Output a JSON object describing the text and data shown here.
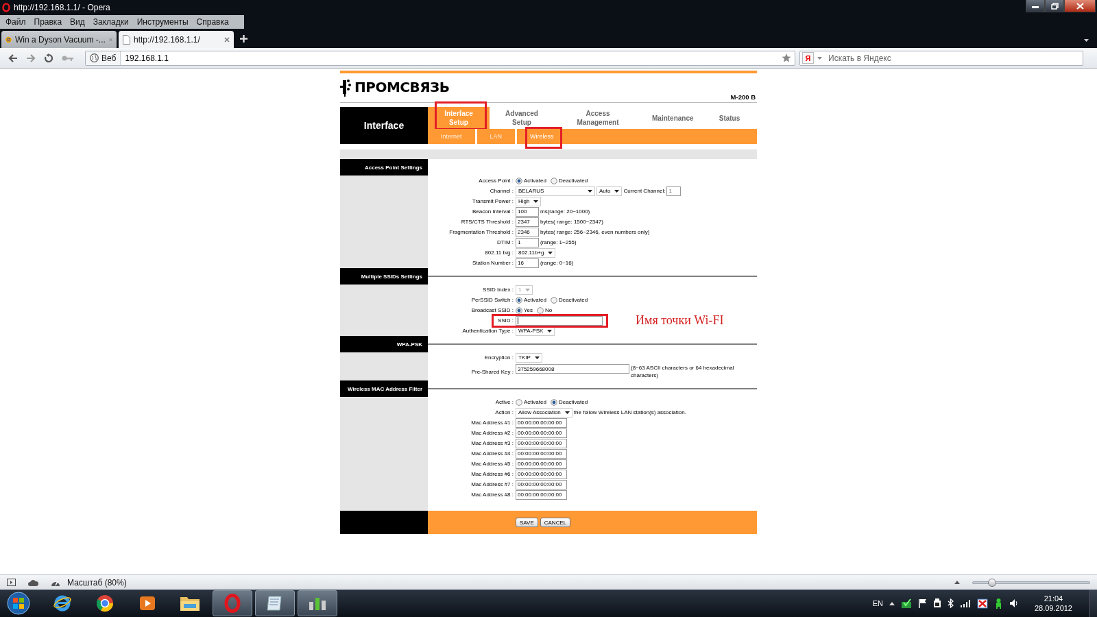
{
  "window": {
    "title": "http://192.168.1.1/ - Opera"
  },
  "menu": [
    "Файл",
    "Правка",
    "Вид",
    "Закладки",
    "Инструменты",
    "Справка"
  ],
  "tabs": [
    {
      "label": "Win a Dyson Vacuum -...",
      "selected": false
    },
    {
      "label": "http://192.168.1.1/",
      "selected": true
    }
  ],
  "address_bar": {
    "mode": "Веб",
    "value": "192.168.1.1"
  },
  "search": {
    "engine": "Я",
    "placeholder": "Искать в Яндекс"
  },
  "router": {
    "logo": "ПРОМСВЯЗЬ",
    "model": "M-200 B",
    "side_title": "Interface",
    "main_tabs": [
      {
        "label": "Interface Setup",
        "selected": true,
        "highlighted": true
      },
      {
        "label": "Advanced Setup",
        "selected": false,
        "highlighted": false
      },
      {
        "label": "Access Management",
        "selected": false,
        "highlighted": false
      },
      {
        "label": "Maintenance",
        "selected": false,
        "highlighted": false
      },
      {
        "label": "Status",
        "selected": false,
        "highlighted": false
      }
    ],
    "sub_tabs": [
      {
        "label": "Internet",
        "selected": false,
        "highlighted": false
      },
      {
        "label": "LAN",
        "selected": false,
        "highlighted": false
      },
      {
        "label": "Wireless",
        "selected": true,
        "highlighted": true
      }
    ],
    "sections": [
      {
        "title": "Access Point Settings",
        "rows": [
          {
            "kind": "radio",
            "label": "Access Point :",
            "options": [
              {
                "label": "Activated",
                "selected": true
              },
              {
                "label": "Deactivated",
                "selected": false
              }
            ]
          },
          {
            "kind": "channel",
            "label": "Channel :",
            "country": "BELARUS",
            "mode": "Auto",
            "current_label": "Current Channel:",
            "current_value": "1"
          },
          {
            "kind": "select",
            "label": "Transmit Power :",
            "value": "High"
          },
          {
            "kind": "number",
            "label": "Beacon Interval :",
            "value": "100",
            "suffix": "ms(range: 20~1000)"
          },
          {
            "kind": "number",
            "label": "RTS/CTS Threshold :",
            "value": "2347",
            "suffix": "bytes( range: 1500~2347)"
          },
          {
            "kind": "number",
            "label": "Fragmentation Threshold :",
            "value": "2346",
            "suffix": "bytes( range: 256~2346, even numbers only)"
          },
          {
            "kind": "number",
            "label": "DTIM :",
            "value": "1",
            "suffix": "(range: 1~255)"
          },
          {
            "kind": "select",
            "label": "802.11 b/g :",
            "value": "802.11b+g"
          },
          {
            "kind": "number",
            "label": "Station Number :",
            "value": "16",
            "suffix": "(range: 0~16)"
          }
        ]
      },
      {
        "title": "Multiple SSIDs Settings",
        "rows": [
          {
            "kind": "select",
            "label": "SSID Index :",
            "value": "1",
            "disabled": true
          },
          {
            "kind": "radio",
            "label": "PerSSID Switch :",
            "options": [
              {
                "label": "Activated",
                "selected": true
              },
              {
                "label": "Deactivated",
                "selected": false
              }
            ]
          },
          {
            "kind": "radio",
            "label": "Broadcast SSID :",
            "options": [
              {
                "label": "Yes",
                "selected": true
              },
              {
                "label": "No",
                "selected": false
              }
            ]
          },
          {
            "kind": "text",
            "label": "SSID :",
            "focused": true,
            "highlighted": true,
            "note": "Имя точки Wi-FI"
          },
          {
            "kind": "select",
            "label": "Authentication Type :",
            "value": "WPA-PSK"
          }
        ]
      },
      {
        "title": "WPA-PSK",
        "rows": [
          {
            "kind": "select",
            "label": "Encryption :",
            "value": "TKIP"
          },
          {
            "kind": "key",
            "label": "Pre-Shared Key :",
            "value": "375259668008",
            "suffix": "(8~63 ASCII characters or 64 hexadecimal characters)"
          }
        ]
      },
      {
        "title": "Wireless MAC Address Filter",
        "rows": [
          {
            "kind": "radio",
            "label": "Active :",
            "options": [
              {
                "label": "Activated",
                "selected": false
              },
              {
                "label": "Deactivated",
                "selected": true
              }
            ]
          },
          {
            "kind": "select",
            "label": "Action :",
            "value": "Allow Association",
            "suffix": "the follow Wireless LAN station(s) association."
          },
          {
            "kind": "mac",
            "label": "Mac Address #1 :",
            "value": "00:00:00:00:00:00"
          },
          {
            "kind": "mac",
            "label": "Mac Address #2 :",
            "value": "00:00:00:00:00:00"
          },
          {
            "kind": "mac",
            "label": "Mac Address #3 :",
            "value": "00:00:00:00:00:00"
          },
          {
            "kind": "mac",
            "label": "Mac Address #4 :",
            "value": "00:00:00:00:00:00"
          },
          {
            "kind": "mac",
            "label": "Mac Address #5 :",
            "value": "00:00:00:00:00:00"
          },
          {
            "kind": "mac",
            "label": "Mac Address #6 :",
            "value": "00:00:00:00:00:00"
          },
          {
            "kind": "mac",
            "label": "Mac Address #7 :",
            "value": "00:00:00:00:00:00"
          },
          {
            "kind": "mac",
            "label": "Mac Address #8 :",
            "value": "00:00:00:00:00:00"
          }
        ]
      }
    ],
    "buttons": [
      "SAVE",
      "CANCEL"
    ]
  },
  "status_bar": {
    "zoom": "Масштаб (80%)",
    "zoom_slider": {
      "level": 0.16
    }
  },
  "taskbar": {
    "apps": [
      {
        "kind": "globe",
        "running": false
      },
      {
        "kind": "sphere",
        "running": false
      },
      {
        "kind": "player",
        "running": false
      },
      {
        "kind": "folder",
        "running": false
      },
      {
        "kind": "ring",
        "running": true
      },
      {
        "kind": "notepad",
        "running": true
      },
      {
        "kind": "gauge",
        "running": true
      }
    ],
    "language": "EN",
    "time": "21:04",
    "date": "28.09.2012"
  }
}
